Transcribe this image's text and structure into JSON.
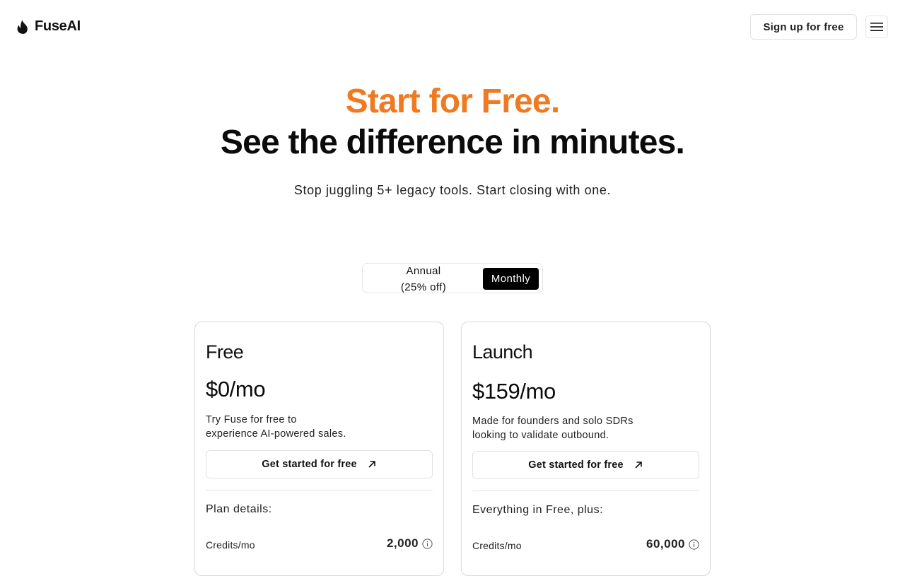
{
  "header": {
    "brand": "FuseAI",
    "signup_label": "Sign up for free",
    "logo_icon": "flame-icon",
    "menu_icon": "hamburger-menu-icon"
  },
  "hero": {
    "title_accent": "Start for Free.",
    "title_main": "See the difference in minutes.",
    "subtitle": "Stop juggling 5+ legacy tools. Start closing with one.",
    "accent_color": "#f07a22"
  },
  "billing_toggle": {
    "annual_line1": "Annual",
    "annual_line2": "(25% off)",
    "monthly_label": "Monthly",
    "selected": "Monthly"
  },
  "plans": [
    {
      "name": "Free",
      "price": "$0/mo",
      "desc_line1": "Try Fuse for free to",
      "desc_line2": "experience AI-powered sales.",
      "cta_label": "Get started for free",
      "details_heading": "Plan details:",
      "credits_label": "Credits/mo",
      "credits_value": "2,000"
    },
    {
      "name": "Launch",
      "price": "$159/mo",
      "desc_line1": "Made for founders and solo SDRs",
      "desc_line2": "looking to validate outbound.",
      "cta_label": "Get started for free",
      "details_heading": "Everything in Free, plus:",
      "credits_label": "Credits/mo",
      "credits_value": "60,000"
    }
  ]
}
